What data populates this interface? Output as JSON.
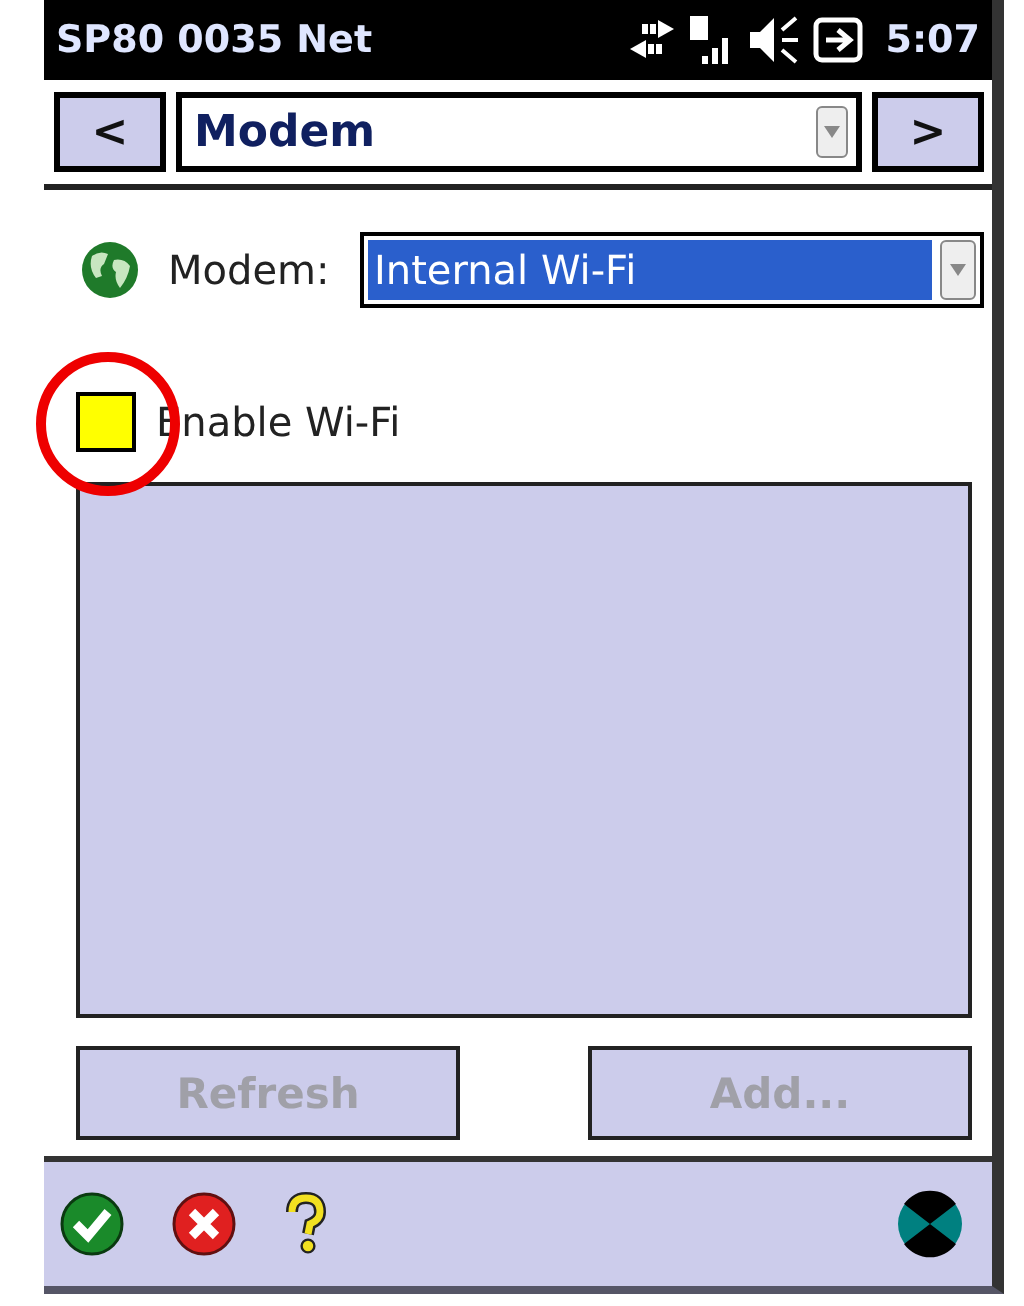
{
  "status_bar": {
    "title": "SP80 0035 Net",
    "time": "5:07"
  },
  "nav": {
    "prev": "<",
    "page": "Modem",
    "next": ">"
  },
  "modem": {
    "label": "Modem:",
    "value": "Internal Wi-Fi"
  },
  "enable_wifi": {
    "label": "Enable Wi-Fi",
    "checked": false,
    "highlighted": true
  },
  "buttons": [
    {
      "label": "Refresh",
      "disabled": true
    },
    {
      "label": "Add...",
      "disabled": true
    }
  ]
}
